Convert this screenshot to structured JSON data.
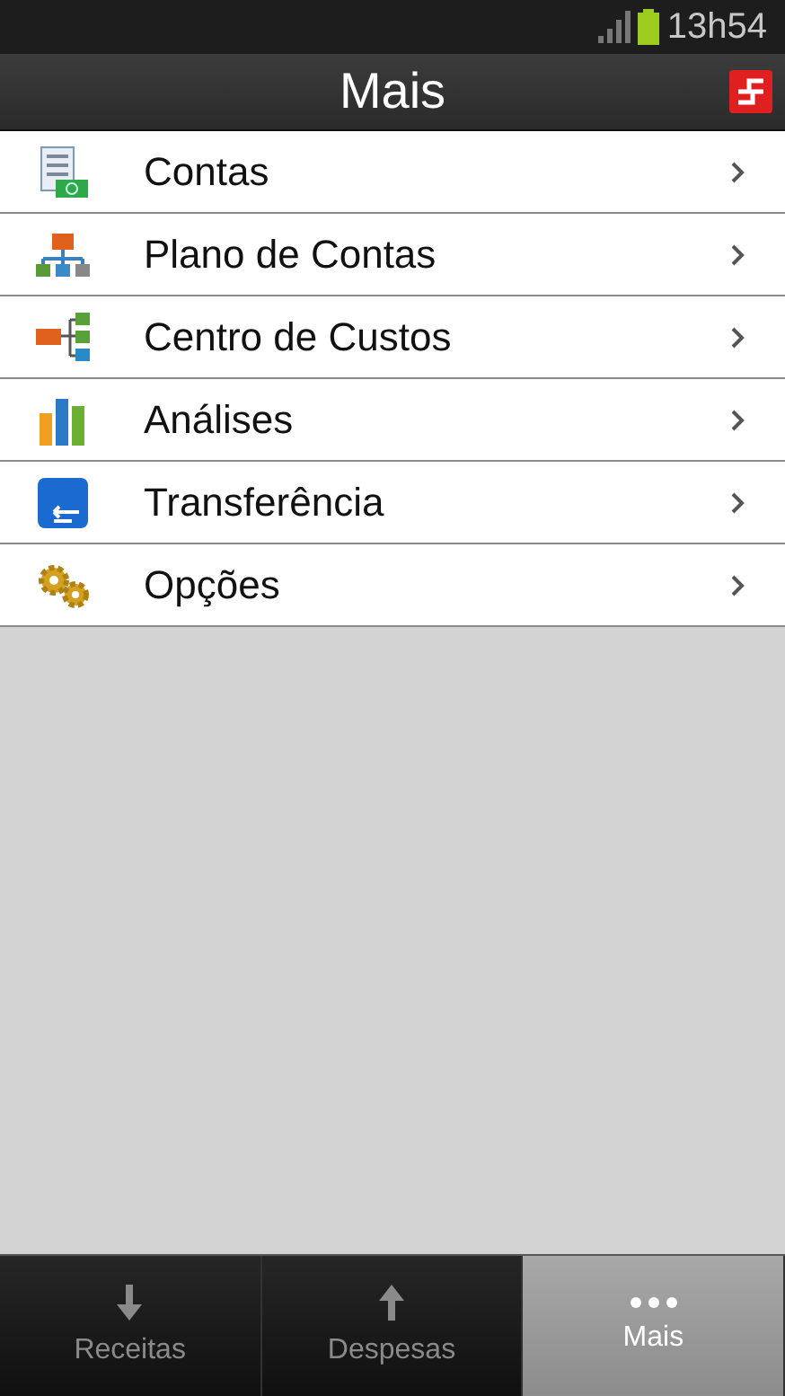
{
  "status_bar": {
    "time": "13h54"
  },
  "header": {
    "title": "Mais"
  },
  "menu": [
    {
      "label": "Contas",
      "kind": "bill"
    },
    {
      "label": "Plano de Contas",
      "kind": "org"
    },
    {
      "label": "Centro de Custos",
      "kind": "tree"
    },
    {
      "label": "Análises",
      "kind": "chart"
    },
    {
      "label": "Transferência",
      "kind": "transfer"
    },
    {
      "label": "Opções",
      "kind": "gears"
    }
  ],
  "tabs": [
    {
      "label": "Receitas",
      "kind": "down",
      "selected": false
    },
    {
      "label": "Despesas",
      "kind": "up",
      "selected": false
    },
    {
      "label": "Mais",
      "kind": "more",
      "selected": true
    }
  ]
}
